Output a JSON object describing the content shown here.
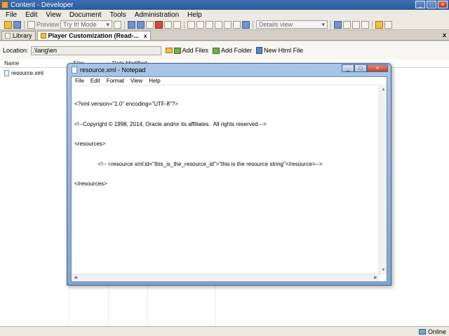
{
  "main_window": {
    "title": "Content - Developer",
    "controls": {
      "minimize": "_",
      "maximize": "□",
      "close": "×"
    }
  },
  "menubar": {
    "items": [
      "File",
      "Edit",
      "View",
      "Document",
      "Tools",
      "Administration",
      "Help"
    ]
  },
  "toolbar": {
    "preview_label": "Preview",
    "mode_combo": "Try It! Mode",
    "view_combo": "Details view"
  },
  "tabs": {
    "library_label": "Library",
    "player_label": "Player Customization (Read-...",
    "close_glyph": "x"
  },
  "location": {
    "label": "Location:",
    "value": ".\\lang\\en",
    "add_files": "Add Files",
    "add_folder": "Add Folder",
    "new_html_file": "New Html File"
  },
  "filelist": {
    "columns": [
      "Name",
      "Size",
      "Date Modified"
    ],
    "rows": [
      {
        "name": "resource.xml"
      }
    ]
  },
  "statusbar": {
    "status": "Online"
  },
  "notepad": {
    "title": "resource.xml - Notepad",
    "menu": [
      "File",
      "Edit",
      "Format",
      "View",
      "Help"
    ],
    "lines": [
      "<?xml version=\"1.0\" encoding=\"UTF-8\"?>",
      "<!--Copyright © 1998, 2014, Oracle and/or its affiliates.  All rights reserved.-->",
      "<resources>",
      "               <!-- <resource xml:id=\"this_is_the_resource_id\">\"this is the resource string\"</resource>-->",
      "</resources>"
    ]
  }
}
